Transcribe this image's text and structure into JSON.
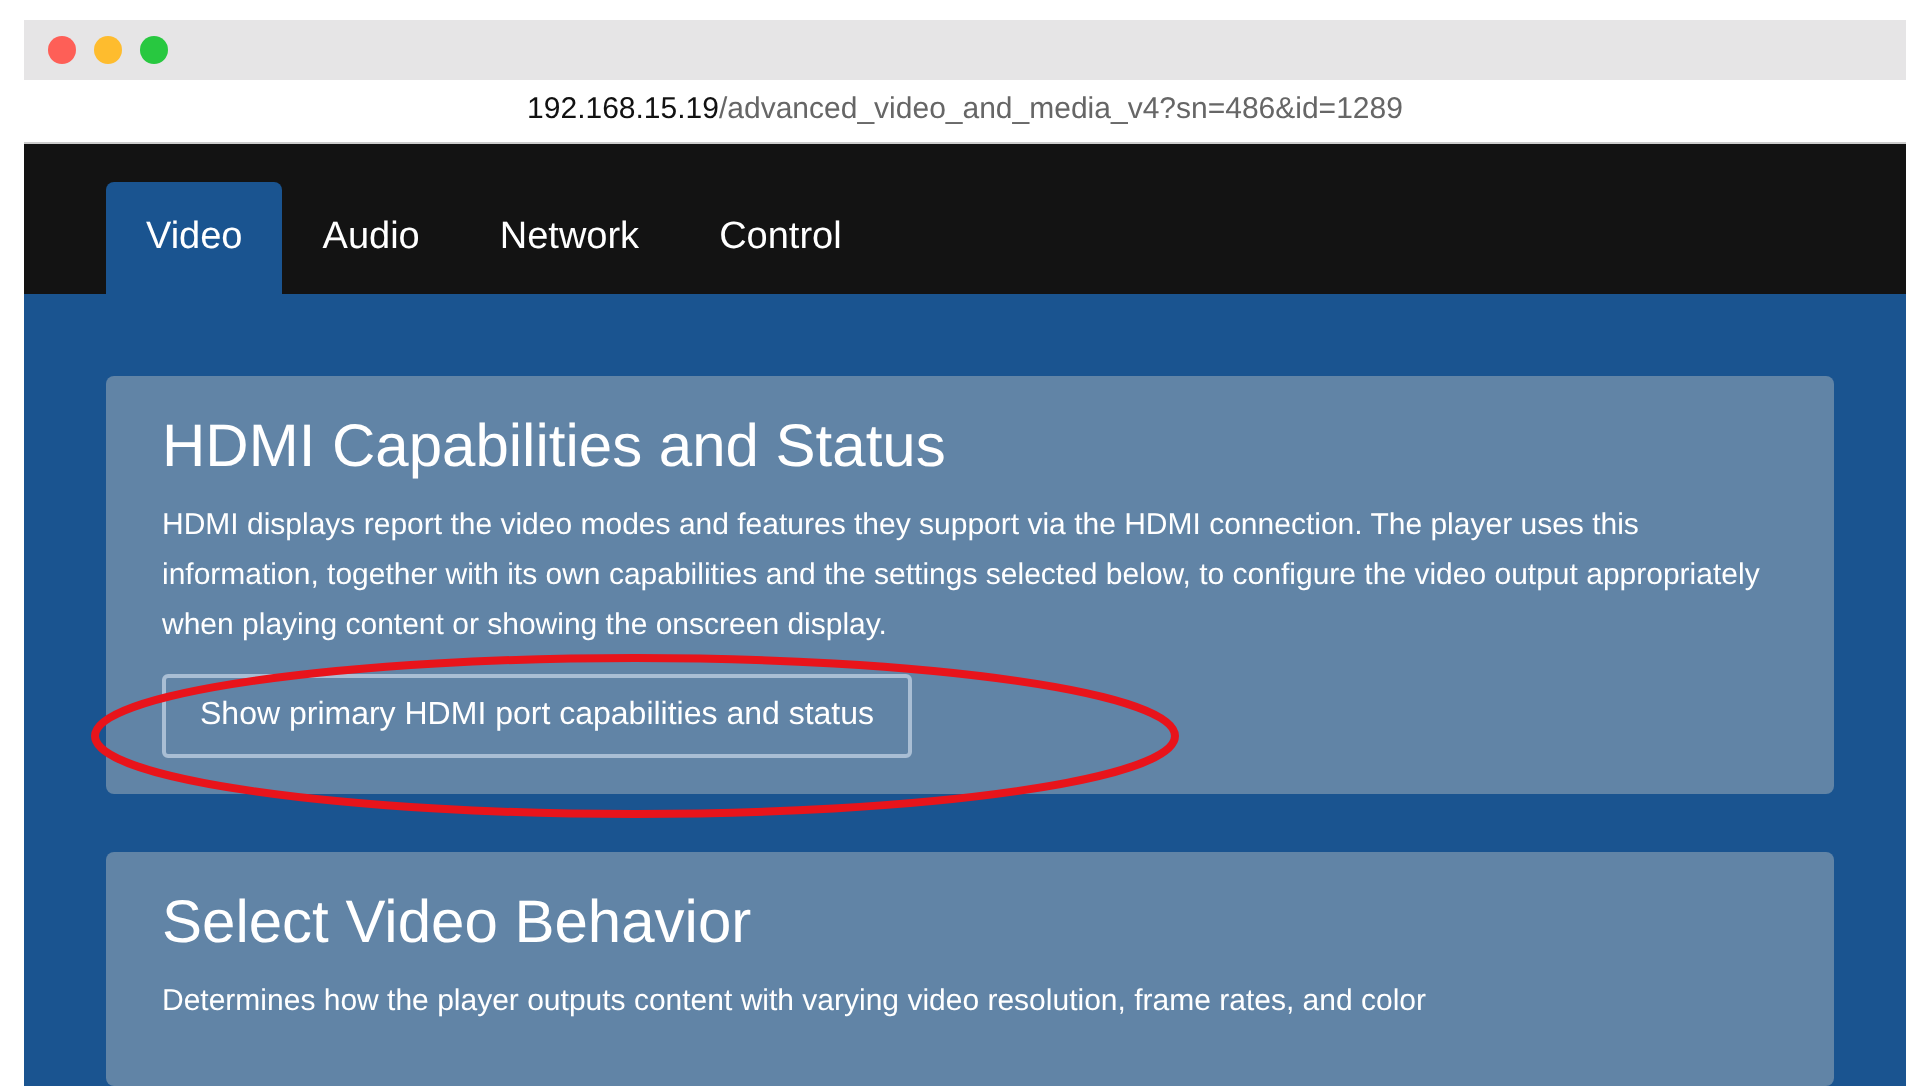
{
  "address_bar": {
    "host": "192.168.15.19",
    "path": "/advanced_video_and_media_v4?sn=486&id=1289"
  },
  "tabs": [
    {
      "label": "Video",
      "selected": true
    },
    {
      "label": "Audio",
      "selected": false
    },
    {
      "label": "Network",
      "selected": false
    },
    {
      "label": "Control",
      "selected": false
    }
  ],
  "sections": [
    {
      "title": "HDMI Capabilities and Status",
      "description": "HDMI displays report the video modes and features they support via the HDMI connection. The player uses this information, together with its own capabilities and the settings selected below, to configure the video output appropriately when playing content or showing the onscreen display.",
      "button": "Show primary HDMI port capabilities and status",
      "annotation": {
        "kind": "ellipse"
      }
    },
    {
      "title": "Select Video Behavior",
      "description": "Determines how the player outputs content with varying video resolution, frame rates, and color"
    }
  ]
}
